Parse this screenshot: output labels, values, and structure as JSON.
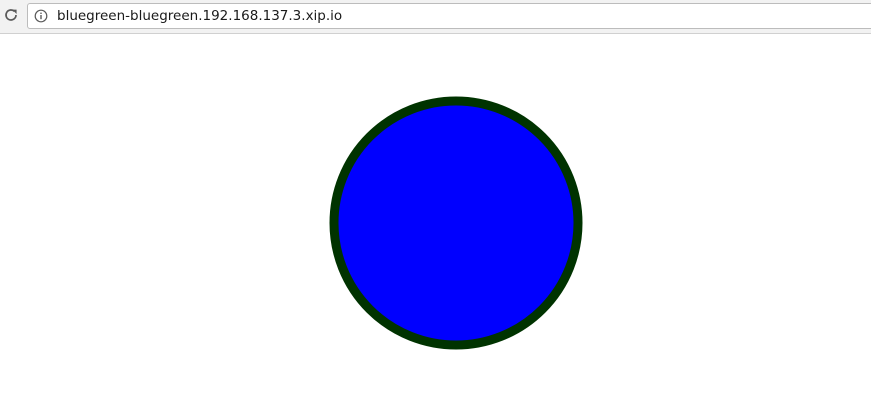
{
  "browser": {
    "reload_icon": "reload-icon",
    "info_icon": "info-circle-icon",
    "url": "bluegreen-bluegreen.192.168.137.3.xip.io"
  },
  "page": {
    "circle": {
      "fill_color": "#0000ff",
      "stroke_color": "#003300"
    }
  }
}
